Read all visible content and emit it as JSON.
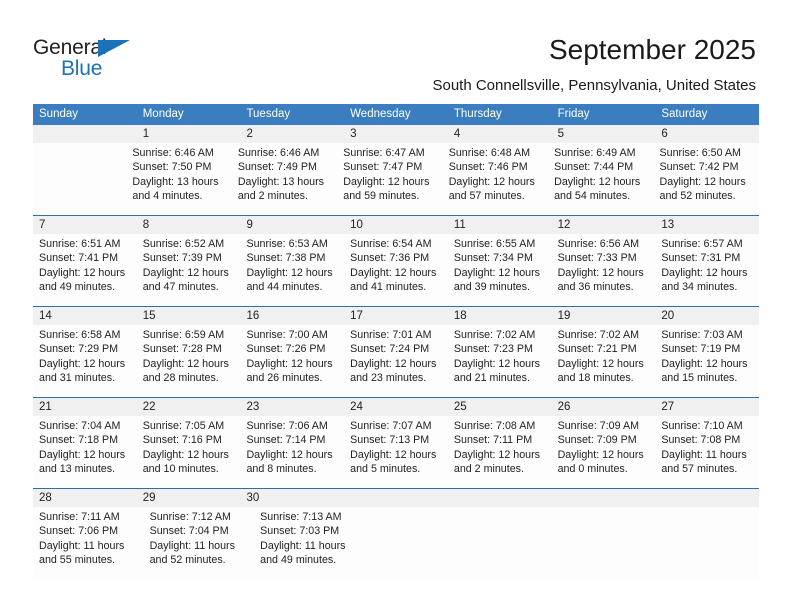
{
  "brand": {
    "name_part1": "General",
    "name_part2": "Blue",
    "accent_color": "#1b72b8"
  },
  "header": {
    "title": "September 2025",
    "subtitle": "South Connellsville, Pennsylvania, United States"
  },
  "calendar": {
    "header_bg": "#3a7ebf",
    "date_band_bg": "#f0f0f0",
    "separator_color": "#2f6ca8",
    "day_names": [
      "Sunday",
      "Monday",
      "Tuesday",
      "Wednesday",
      "Thursday",
      "Friday",
      "Saturday"
    ],
    "weeks": [
      [
        {
          "day": "",
          "lines": []
        },
        {
          "day": "1",
          "lines": [
            "Sunrise: 6:46 AM",
            "Sunset: 7:50 PM",
            "Daylight: 13 hours",
            "and 4 minutes."
          ]
        },
        {
          "day": "2",
          "lines": [
            "Sunrise: 6:46 AM",
            "Sunset: 7:49 PM",
            "Daylight: 13 hours",
            "and 2 minutes."
          ]
        },
        {
          "day": "3",
          "lines": [
            "Sunrise: 6:47 AM",
            "Sunset: 7:47 PM",
            "Daylight: 12 hours",
            "and 59 minutes."
          ]
        },
        {
          "day": "4",
          "lines": [
            "Sunrise: 6:48 AM",
            "Sunset: 7:46 PM",
            "Daylight: 12 hours",
            "and 57 minutes."
          ]
        },
        {
          "day": "5",
          "lines": [
            "Sunrise: 6:49 AM",
            "Sunset: 7:44 PM",
            "Daylight: 12 hours",
            "and 54 minutes."
          ]
        },
        {
          "day": "6",
          "lines": [
            "Sunrise: 6:50 AM",
            "Sunset: 7:42 PM",
            "Daylight: 12 hours",
            "and 52 minutes."
          ]
        }
      ],
      [
        {
          "day": "7",
          "lines": [
            "Sunrise: 6:51 AM",
            "Sunset: 7:41 PM",
            "Daylight: 12 hours",
            "and 49 minutes."
          ]
        },
        {
          "day": "8",
          "lines": [
            "Sunrise: 6:52 AM",
            "Sunset: 7:39 PM",
            "Daylight: 12 hours",
            "and 47 minutes."
          ]
        },
        {
          "day": "9",
          "lines": [
            "Sunrise: 6:53 AM",
            "Sunset: 7:38 PM",
            "Daylight: 12 hours",
            "and 44 minutes."
          ]
        },
        {
          "day": "10",
          "lines": [
            "Sunrise: 6:54 AM",
            "Sunset: 7:36 PM",
            "Daylight: 12 hours",
            "and 41 minutes."
          ]
        },
        {
          "day": "11",
          "lines": [
            "Sunrise: 6:55 AM",
            "Sunset: 7:34 PM",
            "Daylight: 12 hours",
            "and 39 minutes."
          ]
        },
        {
          "day": "12",
          "lines": [
            "Sunrise: 6:56 AM",
            "Sunset: 7:33 PM",
            "Daylight: 12 hours",
            "and 36 minutes."
          ]
        },
        {
          "day": "13",
          "lines": [
            "Sunrise: 6:57 AM",
            "Sunset: 7:31 PM",
            "Daylight: 12 hours",
            "and 34 minutes."
          ]
        }
      ],
      [
        {
          "day": "14",
          "lines": [
            "Sunrise: 6:58 AM",
            "Sunset: 7:29 PM",
            "Daylight: 12 hours",
            "and 31 minutes."
          ]
        },
        {
          "day": "15",
          "lines": [
            "Sunrise: 6:59 AM",
            "Sunset: 7:28 PM",
            "Daylight: 12 hours",
            "and 28 minutes."
          ]
        },
        {
          "day": "16",
          "lines": [
            "Sunrise: 7:00 AM",
            "Sunset: 7:26 PM",
            "Daylight: 12 hours",
            "and 26 minutes."
          ]
        },
        {
          "day": "17",
          "lines": [
            "Sunrise: 7:01 AM",
            "Sunset: 7:24 PM",
            "Daylight: 12 hours",
            "and 23 minutes."
          ]
        },
        {
          "day": "18",
          "lines": [
            "Sunrise: 7:02 AM",
            "Sunset: 7:23 PM",
            "Daylight: 12 hours",
            "and 21 minutes."
          ]
        },
        {
          "day": "19",
          "lines": [
            "Sunrise: 7:02 AM",
            "Sunset: 7:21 PM",
            "Daylight: 12 hours",
            "and 18 minutes."
          ]
        },
        {
          "day": "20",
          "lines": [
            "Sunrise: 7:03 AM",
            "Sunset: 7:19 PM",
            "Daylight: 12 hours",
            "and 15 minutes."
          ]
        }
      ],
      [
        {
          "day": "21",
          "lines": [
            "Sunrise: 7:04 AM",
            "Sunset: 7:18 PM",
            "Daylight: 12 hours",
            "and 13 minutes."
          ]
        },
        {
          "day": "22",
          "lines": [
            "Sunrise: 7:05 AM",
            "Sunset: 7:16 PM",
            "Daylight: 12 hours",
            "and 10 minutes."
          ]
        },
        {
          "day": "23",
          "lines": [
            "Sunrise: 7:06 AM",
            "Sunset: 7:14 PM",
            "Daylight: 12 hours",
            "and 8 minutes."
          ]
        },
        {
          "day": "24",
          "lines": [
            "Sunrise: 7:07 AM",
            "Sunset: 7:13 PM",
            "Daylight: 12 hours",
            "and 5 minutes."
          ]
        },
        {
          "day": "25",
          "lines": [
            "Sunrise: 7:08 AM",
            "Sunset: 7:11 PM",
            "Daylight: 12 hours",
            "and 2 minutes."
          ]
        },
        {
          "day": "26",
          "lines": [
            "Sunrise: 7:09 AM",
            "Sunset: 7:09 PM",
            "Daylight: 12 hours",
            "and 0 minutes."
          ]
        },
        {
          "day": "27",
          "lines": [
            "Sunrise: 7:10 AM",
            "Sunset: 7:08 PM",
            "Daylight: 11 hours",
            "and 57 minutes."
          ]
        }
      ],
      [
        {
          "day": "28",
          "lines": [
            "Sunrise: 7:11 AM",
            "Sunset: 7:06 PM",
            "Daylight: 11 hours",
            "and 55 minutes."
          ]
        },
        {
          "day": "29",
          "lines": [
            "Sunrise: 7:12 AM",
            "Sunset: 7:04 PM",
            "Daylight: 11 hours",
            "and 52 minutes."
          ]
        },
        {
          "day": "30",
          "lines": [
            "Sunrise: 7:13 AM",
            "Sunset: 7:03 PM",
            "Daylight: 11 hours",
            "and 49 minutes."
          ]
        },
        {
          "day": "",
          "lines": []
        },
        {
          "day": "",
          "lines": []
        },
        {
          "day": "",
          "lines": []
        },
        {
          "day": "",
          "lines": []
        }
      ]
    ]
  }
}
